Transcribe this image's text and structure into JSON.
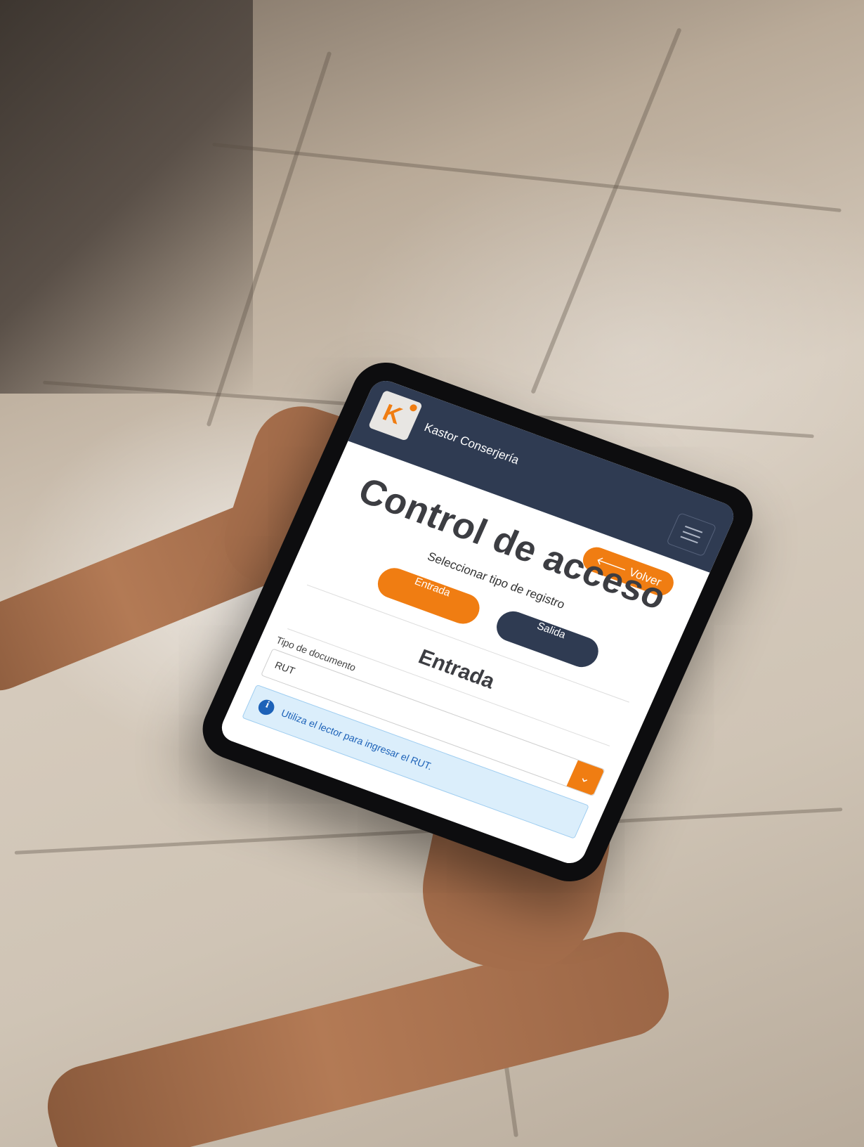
{
  "app": {
    "brand_name": "Kastor Conserjería",
    "logo_letter": "K"
  },
  "header": {
    "menu_icon": "hamburger-menu-icon",
    "back_label": "🡐 Volver"
  },
  "page": {
    "title": "Control de acceso",
    "subtitle": "Seleccionar tipo de registro"
  },
  "register_type": {
    "entrada_label": "Entrada",
    "salida_label": "Salida",
    "selected": "Entrada"
  },
  "form": {
    "section_title": "Entrada",
    "document_type": {
      "label": "Tipo de documento",
      "value": "RUT",
      "arrow_icon": "chevron-down-icon"
    },
    "info_alert": {
      "icon": "info-icon",
      "text": "Utiliza el lector para ingresar el RUT."
    }
  },
  "colors": {
    "accent": "#f07d12",
    "navbar": "#2f3b52",
    "info_text": "#1d62b8",
    "info_bg": "#dbeefb"
  }
}
